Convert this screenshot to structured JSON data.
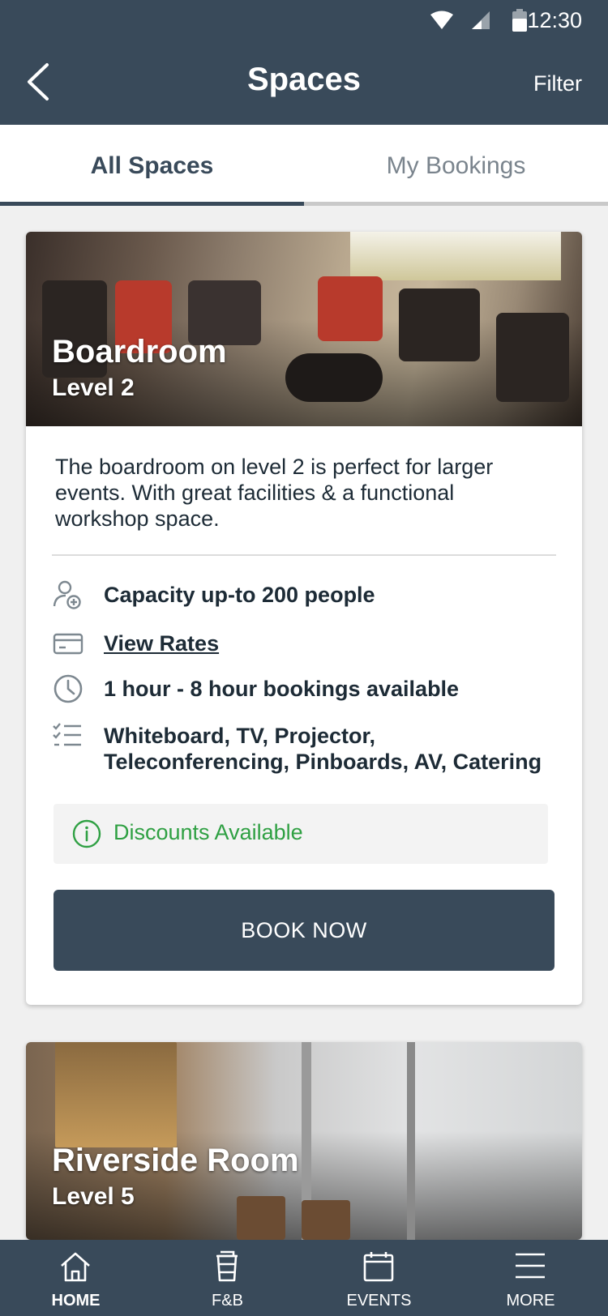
{
  "status_bar": {
    "time": "12:30"
  },
  "app_bar": {
    "title": "Spaces",
    "filter_label": "Filter"
  },
  "tabs": [
    {
      "label": "All Spaces",
      "active": true
    },
    {
      "label": "My Bookings",
      "active": false
    }
  ],
  "spaces": [
    {
      "name": "Boardroom",
      "level": "Level 2",
      "description": "The boardroom on level 2 is perfect for larger events. With great facilities & a functional workshop space.",
      "features": [
        {
          "icon": "add-user-icon",
          "text": "Capacity up-to 200 people"
        },
        {
          "icon": "credit-card-icon",
          "text": "View Rates"
        },
        {
          "icon": "clock-icon",
          "text": "1 hour - 8 hour bookings available"
        },
        {
          "icon": "checklist-icon",
          "text": "Whiteboard, TV, Projector, Teleconferencing, Pinboards, AV, Catering"
        }
      ],
      "discount": "Discounts Available",
      "cta": "BOOK NOW"
    },
    {
      "name": "Riverside Room",
      "level": "Level 5"
    }
  ],
  "bottom_nav": [
    {
      "icon": "home-icon",
      "label": "HOME",
      "active": true
    },
    {
      "icon": "cup-icon",
      "label": "F&B",
      "active": false
    },
    {
      "icon": "calendar-icon",
      "label": "EVENTS",
      "active": false
    },
    {
      "icon": "menu-icon",
      "label": "MORE",
      "active": false
    }
  ],
  "colors": {
    "primary": "#394a5a",
    "discount_green": "#2fa043",
    "background": "#f0f0f0"
  }
}
